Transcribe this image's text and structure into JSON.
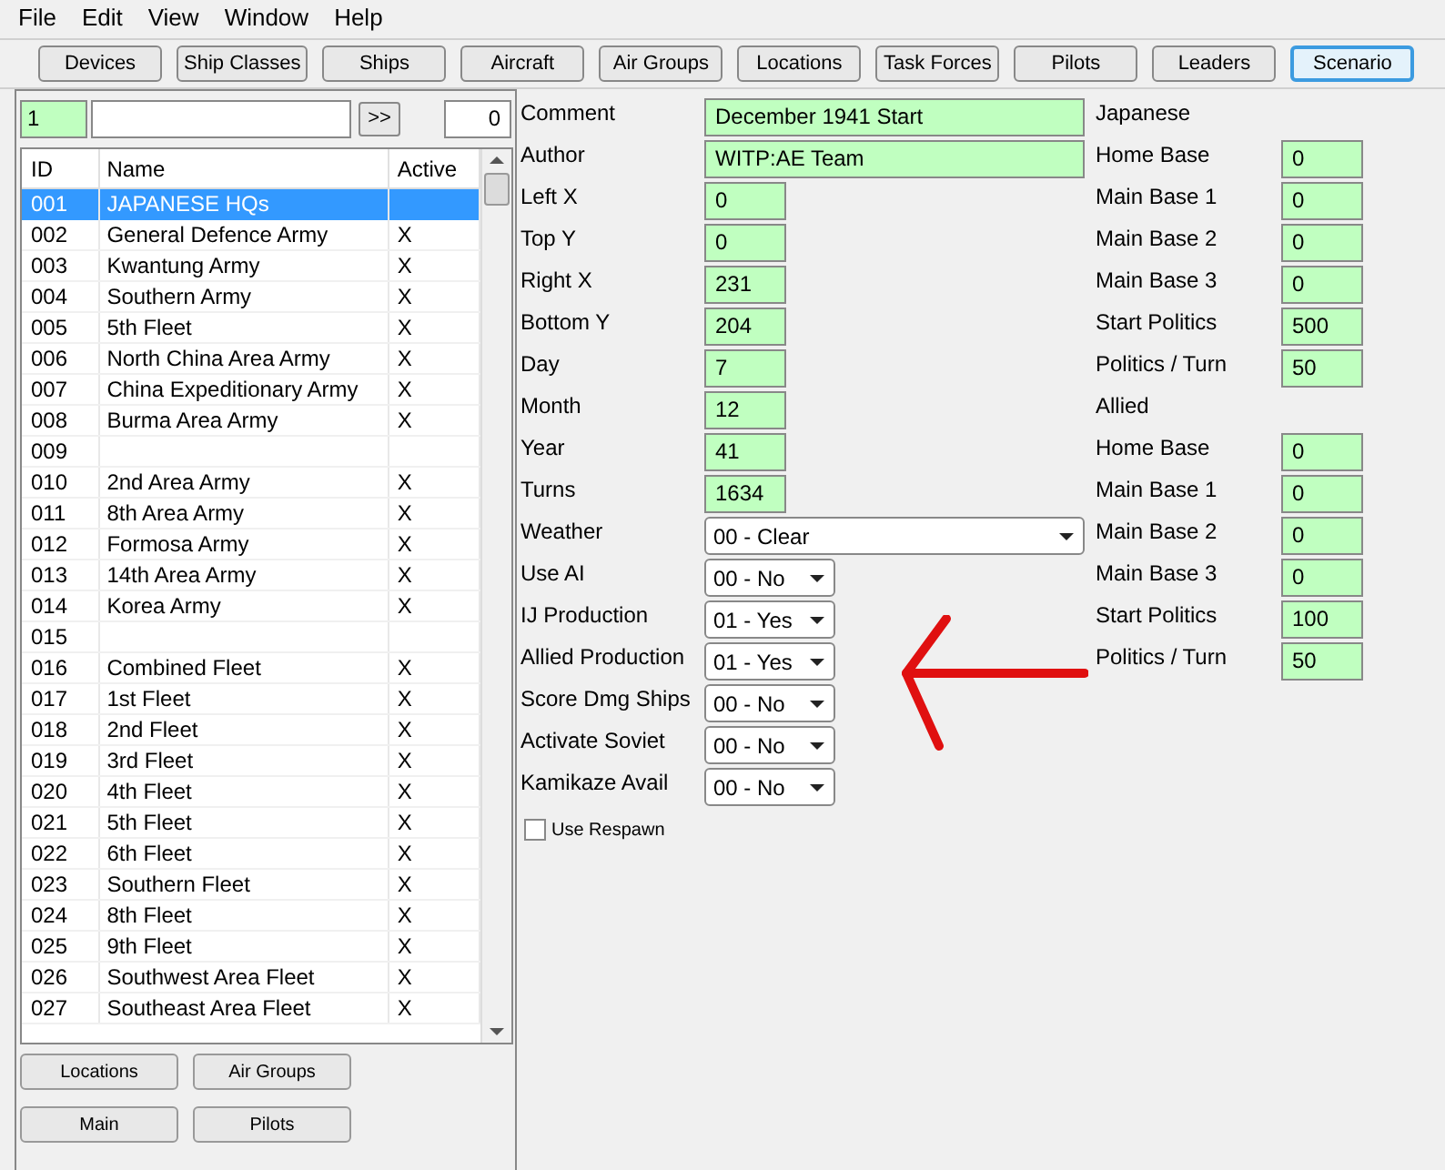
{
  "menu": [
    "File",
    "Edit",
    "View",
    "Window",
    "Help"
  ],
  "tabs": [
    {
      "label": "Devices",
      "selected": false
    },
    {
      "label": "Ship Classes",
      "selected": false
    },
    {
      "label": "Ships",
      "selected": false
    },
    {
      "label": "Aircraft",
      "selected": false
    },
    {
      "label": "Air Groups",
      "selected": false
    },
    {
      "label": "Locations",
      "selected": false
    },
    {
      "label": "Task Forces",
      "selected": false
    },
    {
      "label": "Pilots",
      "selected": false
    },
    {
      "label": "Leaders",
      "selected": false
    },
    {
      "label": "Scenario",
      "selected": true
    }
  ],
  "finder": {
    "id_value": "1",
    "go_button": ">>",
    "count": "0"
  },
  "table": {
    "columns": [
      "ID",
      "Name",
      "Active"
    ],
    "rows": [
      {
        "id": "001",
        "name": "JAPANESE HQs",
        "selected": true
      },
      {
        "id": "002",
        "name": "General Defence Army",
        "active": "X",
        "selected": false
      },
      {
        "id": "003",
        "name": "Kwantung Army",
        "active": "X",
        "selected": false
      },
      {
        "id": "004",
        "name": "Southern Army",
        "active": "X",
        "selected": false
      },
      {
        "id": "005",
        "name": "5th Fleet",
        "active": "X",
        "selected": false
      },
      {
        "id": "006",
        "name": "North China Area Army",
        "active": "X",
        "selected": false
      },
      {
        "id": "007",
        "name": "China Expeditionary Army",
        "active": "X",
        "selected": false
      },
      {
        "id": "008",
        "name": "Burma Area Army",
        "active": "X",
        "selected": false
      },
      {
        "id": "009",
        "selected": false
      },
      {
        "id": "010",
        "name": "2nd Area Army",
        "active": "X",
        "selected": false
      },
      {
        "id": "011",
        "name": "8th Area Army",
        "active": "X",
        "selected": false
      },
      {
        "id": "012",
        "name": "Formosa Army",
        "active": "X",
        "selected": false
      },
      {
        "id": "013",
        "name": "14th Area Army",
        "active": "X",
        "selected": false
      },
      {
        "id": "014",
        "name": "Korea Army",
        "active": "X",
        "selected": false
      },
      {
        "id": "015",
        "selected": false
      },
      {
        "id": "016",
        "name": "Combined Fleet",
        "active": "X",
        "selected": false
      },
      {
        "id": "017",
        "name": "1st Fleet",
        "active": "X",
        "selected": false
      },
      {
        "id": "018",
        "name": "2nd Fleet",
        "active": "X",
        "selected": false
      },
      {
        "id": "019",
        "name": "3rd Fleet",
        "active": "X",
        "selected": false
      },
      {
        "id": "020",
        "name": "4th Fleet",
        "active": "X",
        "selected": false
      },
      {
        "id": "021",
        "name": "5th Fleet",
        "active": "X",
        "selected": false
      },
      {
        "id": "022",
        "name": "6th Fleet",
        "active": "X",
        "selected": false
      },
      {
        "id": "023",
        "name": "Southern Fleet",
        "active": "X",
        "selected": false
      },
      {
        "id": "024",
        "name": "8th Fleet",
        "active": "X",
        "selected": false
      },
      {
        "id": "025",
        "name": "9th Fleet",
        "active": "X",
        "selected": false
      },
      {
        "id": "026",
        "name": "Southwest Area Fleet",
        "active": "X",
        "selected": false
      },
      {
        "id": "027",
        "name": "Southeast Area Fleet",
        "active": "X",
        "selected": false
      }
    ]
  },
  "bottom_buttons": [
    "Locations",
    "Air Groups",
    "Main",
    "Pilots"
  ],
  "fields": [
    {
      "label": "Comment",
      "kind": "wide_text",
      "value": "December 1941 Start"
    },
    {
      "label": "Author",
      "kind": "wide_text",
      "value": "WITP:AE Team"
    },
    {
      "label": "Left X",
      "kind": "text",
      "value": "0"
    },
    {
      "label": "Top Y",
      "kind": "text",
      "value": "0"
    },
    {
      "label": "Right X",
      "kind": "text",
      "value": "231"
    },
    {
      "label": "Bottom Y",
      "kind": "text",
      "value": "204"
    },
    {
      "label": "Day",
      "kind": "text",
      "value": "7"
    },
    {
      "label": "Month",
      "kind": "text",
      "value": "12"
    },
    {
      "label": "Year",
      "kind": "text",
      "value": "41"
    },
    {
      "label": "Turns",
      "kind": "text",
      "value": "1634"
    },
    {
      "label": "Weather",
      "kind": "wide_select",
      "value": "00 - Clear"
    },
    {
      "label": "Use AI",
      "kind": "select",
      "value": "00 - No"
    },
    {
      "label": "IJ Production",
      "kind": "select",
      "value": "01 - Yes"
    },
    {
      "label": "Allied Production",
      "kind": "select",
      "value": "01 - Yes"
    },
    {
      "label": "Score Dmg Ships",
      "kind": "select",
      "value": "00 - No"
    },
    {
      "label": "Activate Soviet",
      "kind": "select",
      "value": "00 - No"
    },
    {
      "label": "Kamikaze Avail",
      "kind": "select",
      "value": "00 - No"
    }
  ],
  "use_respawn": {
    "label": "Use Respawn",
    "checked": false
  },
  "side_fields": [
    {
      "label": "Japanese",
      "kind": "heading"
    },
    {
      "label": "Home Base",
      "kind": "text",
      "value": "0"
    },
    {
      "label": "Main Base 1",
      "kind": "text",
      "value": "0"
    },
    {
      "label": "Main Base 2",
      "kind": "text",
      "value": "0"
    },
    {
      "label": "Main Base 3",
      "kind": "text",
      "value": "0"
    },
    {
      "label": "Start Politics",
      "kind": "text",
      "value": "500"
    },
    {
      "label": "Politics / Turn",
      "kind": "text",
      "value": "50"
    },
    {
      "label": "Allied",
      "kind": "heading"
    },
    {
      "label": "Home Base",
      "kind": "text",
      "value": "0"
    },
    {
      "label": "Main Base 1",
      "kind": "text",
      "value": "0"
    },
    {
      "label": "Main Base 2",
      "kind": "text",
      "value": "0"
    },
    {
      "label": "Main Base 3",
      "kind": "text",
      "value": "0"
    },
    {
      "label": "Start Politics",
      "kind": "text",
      "value": "100"
    },
    {
      "label": "Politics / Turn",
      "kind": "text",
      "value": "50"
    }
  ]
}
